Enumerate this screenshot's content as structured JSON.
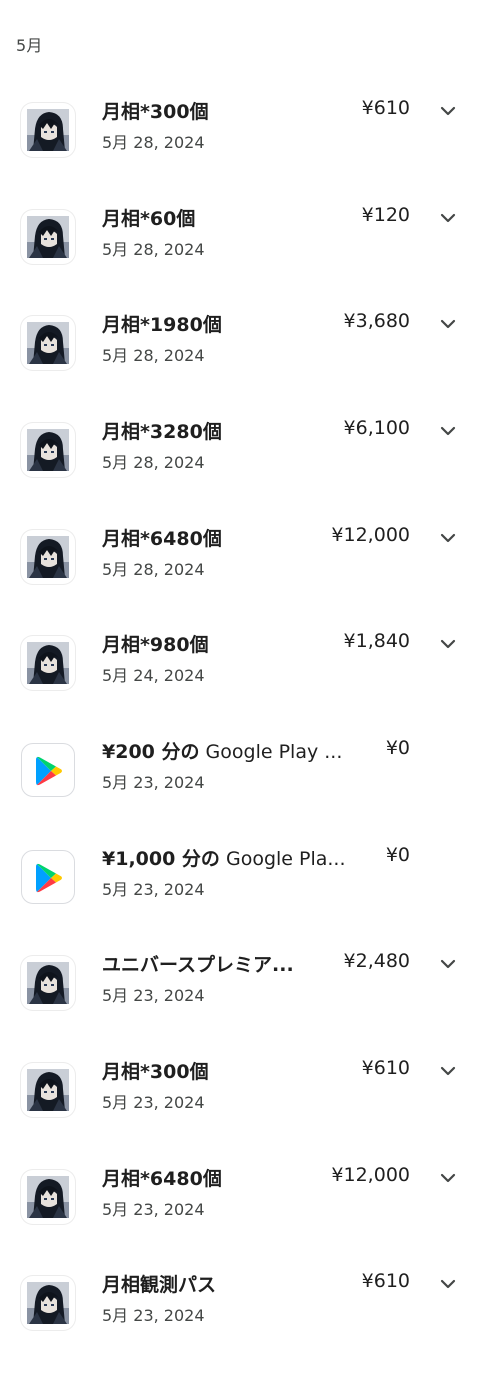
{
  "month_header": "5月",
  "transactions": [
    {
      "title": "月相*300個",
      "date": "5月 28, 2024",
      "price": "¥610",
      "icon": "game-character-icon",
      "expandable": true
    },
    {
      "title": "月相*60個",
      "date": "5月 28, 2024",
      "price": "¥120",
      "icon": "game-character-icon",
      "expandable": true
    },
    {
      "title": "月相*1980個",
      "date": "5月 28, 2024",
      "price": "¥3,680",
      "icon": "game-character-icon",
      "expandable": true
    },
    {
      "title": "月相*3280個",
      "date": "5月 28, 2024",
      "price": "¥6,100",
      "icon": "game-character-icon",
      "expandable": true
    },
    {
      "title": "月相*6480個",
      "date": "5月 28, 2024",
      "price": "¥12,000",
      "icon": "game-character-icon",
      "expandable": true
    },
    {
      "title": "月相*980個",
      "date": "5月 24, 2024",
      "price": "¥1,840",
      "icon": "game-character-icon",
      "expandable": true
    },
    {
      "title_bold": "¥200 分の",
      "title_rest": " Google Play ...",
      "date": "5月 23, 2024",
      "price": "¥0",
      "icon": "google-play-icon",
      "expandable": false
    },
    {
      "title_bold": "¥1,000 分の",
      "title_rest": " Google Pla...",
      "date": "5月 23, 2024",
      "price": "¥0",
      "icon": "google-play-icon",
      "expandable": false
    },
    {
      "title": "ユニバースプレミア...",
      "date": "5月 23, 2024",
      "price": "¥2,480",
      "icon": "game-character-icon",
      "expandable": true
    },
    {
      "title": "月相*300個",
      "date": "5月 23, 2024",
      "price": "¥610",
      "icon": "game-character-icon",
      "expandable": true
    },
    {
      "title": "月相*6480個",
      "date": "5月 23, 2024",
      "price": "¥12,000",
      "icon": "game-character-icon",
      "expandable": true
    },
    {
      "title": "月相観測パス",
      "date": "5月 23, 2024",
      "price": "¥610",
      "icon": "game-character-icon",
      "expandable": true
    }
  ],
  "colors": {
    "text_primary": "#1f1f1f",
    "text_secondary": "#444746",
    "chevron": "#444746",
    "play_blue": "#00a0ff",
    "play_green": "#00d36e",
    "play_yellow": "#ffc900",
    "play_red": "#ff3a44"
  }
}
